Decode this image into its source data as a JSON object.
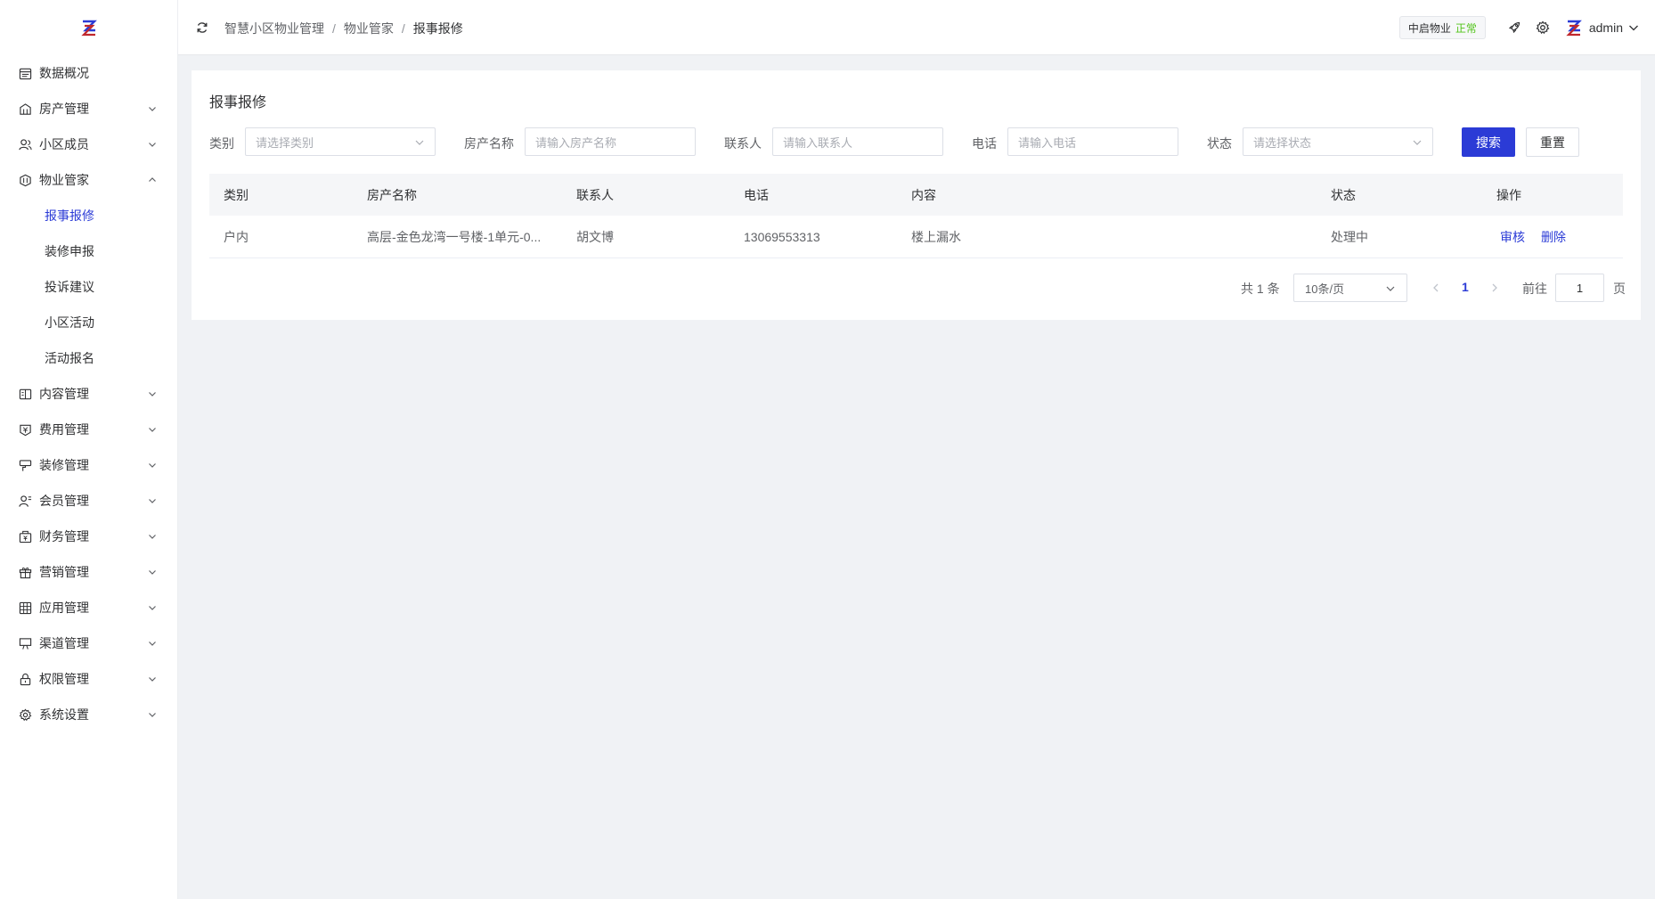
{
  "sidebar": {
    "logo_text": "Z",
    "items": [
      {
        "label": "数据概况",
        "icon": "calendar-icon",
        "has_arrow": false
      },
      {
        "label": "房产管理",
        "icon": "building-icon",
        "has_arrow": true
      },
      {
        "label": "小区成员",
        "icon": "users-icon",
        "has_arrow": true
      },
      {
        "label": "物业管家",
        "icon": "steward-icon",
        "has_arrow": true,
        "expanded": true
      }
    ],
    "submenu": [
      {
        "label": "报事报修",
        "active": true
      },
      {
        "label": "装修申报"
      },
      {
        "label": "投诉建议"
      },
      {
        "label": "小区活动"
      },
      {
        "label": "活动报名"
      }
    ],
    "items_after": [
      {
        "label": "内容管理",
        "icon": "book-icon"
      },
      {
        "label": "费用管理",
        "icon": "fee-icon"
      },
      {
        "label": "装修管理",
        "icon": "paint-icon"
      },
      {
        "label": "会员管理",
        "icon": "member-icon"
      },
      {
        "label": "财务管理",
        "icon": "finance-icon"
      },
      {
        "label": "营销管理",
        "icon": "gift-icon"
      },
      {
        "label": "应用管理",
        "icon": "grid-icon"
      },
      {
        "label": "渠道管理",
        "icon": "channel-icon"
      },
      {
        "label": "权限管理",
        "icon": "lock-icon"
      },
      {
        "label": "系统设置",
        "icon": "gear-icon"
      }
    ]
  },
  "header": {
    "breadcrumb": [
      "智慧小区物业管理",
      "物业管家",
      "报事报修"
    ],
    "separator": "/",
    "tenant_name": "中启物业",
    "tenant_status": "正常",
    "username": "admin"
  },
  "page": {
    "title": "报事报修",
    "filters": {
      "category_label": "类别",
      "category_placeholder": "请选择类别",
      "property_label": "房产名称",
      "property_placeholder": "请输入房产名称",
      "contact_label": "联系人",
      "contact_placeholder": "请输入联系人",
      "phone_label": "电话",
      "phone_placeholder": "请输入电话",
      "status_label": "状态",
      "status_placeholder": "请选择状态",
      "search_button": "搜索",
      "reset_button": "重置"
    },
    "table": {
      "columns": [
        "类别",
        "房产名称",
        "联系人",
        "电话",
        "内容",
        "状态",
        "操作"
      ],
      "rows": [
        {
          "category": "户内",
          "property": "高层-金色龙湾一号楼-1单元-0...",
          "contact": "胡文博",
          "phone": "13069553313",
          "content": "楼上漏水",
          "status": "处理中",
          "action_review": "审核",
          "action_delete": "删除"
        }
      ]
    },
    "pagination": {
      "total_text": "共 1 条",
      "page_size": "10条/页",
      "current_page": "1",
      "goto_label": "前往",
      "goto_value": "1",
      "page_suffix": "页"
    }
  },
  "colors": {
    "primary": "#2b3bd6",
    "status_ok": "#52c41a",
    "logo_red": "#c0282d"
  }
}
